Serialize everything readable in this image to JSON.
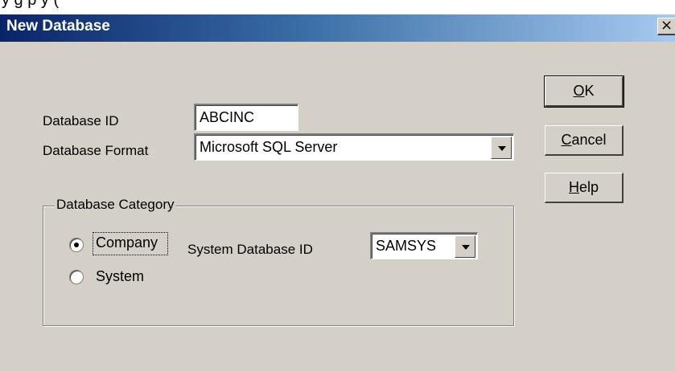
{
  "background_text": "y   g   p y (",
  "window": {
    "title": "New Database",
    "close_label": "×"
  },
  "fields": {
    "database_id_label": "Database ID",
    "database_id_value": "ABCINC",
    "database_format_label": "Database Format",
    "database_format_value": "Microsoft SQL Server"
  },
  "buttons": {
    "ok_underline": "O",
    "ok_rest": "K",
    "cancel_underline": "C",
    "cancel_rest": "ancel",
    "help_underline": "H",
    "help_rest": "elp"
  },
  "category": {
    "legend": "Database Category",
    "company_label": "Company",
    "system_label": "System",
    "selected": "Company",
    "system_db_id_label": "System Database ID",
    "system_db_id_value": "SAMSYS"
  },
  "colors": {
    "titlebar_start": "#0a246a",
    "titlebar_end": "#a6caf0",
    "dialog_bg": "#d4d0c8"
  }
}
